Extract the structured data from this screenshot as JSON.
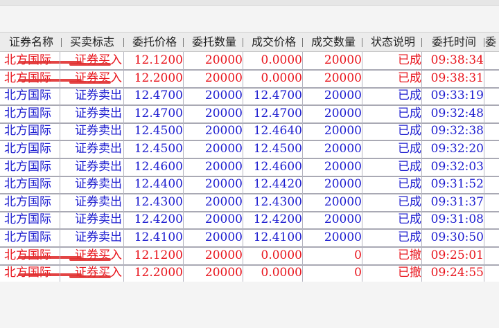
{
  "colors": {
    "buy": "#e8141c",
    "sell": "#1c1ccf",
    "header_text": "#222222",
    "strike_mark": "#e03030"
  },
  "columns": [
    {
      "key": "name",
      "label": "证券名称"
    },
    {
      "key": "direction",
      "label": "买卖标志"
    },
    {
      "key": "order_price",
      "label": "委托价格"
    },
    {
      "key": "order_qty",
      "label": "委托数量"
    },
    {
      "key": "deal_price",
      "label": "成交价格"
    },
    {
      "key": "deal_qty",
      "label": "成交数量"
    },
    {
      "key": "status",
      "label": "状态说明"
    },
    {
      "key": "order_time",
      "label": "委托时间"
    },
    {
      "key": "extra",
      "label": "委"
    }
  ],
  "rows": [
    {
      "name": "北方国际",
      "direction": "证券买入",
      "order_price": "12.1200",
      "order_qty": "20000",
      "deal_price": "0.0000",
      "deal_qty": "20000",
      "status": "已成",
      "order_time": "09:38:34",
      "side": "buy",
      "redacted": true
    },
    {
      "name": "北方国际",
      "direction": "证券买入",
      "order_price": "12.2000",
      "order_qty": "20000",
      "deal_price": "0.0000",
      "deal_qty": "20000",
      "status": "已成",
      "order_time": "09:38:31",
      "side": "buy",
      "redacted": true
    },
    {
      "name": "北方国际",
      "direction": "证券卖出",
      "order_price": "12.4700",
      "order_qty": "20000",
      "deal_price": "12.4700",
      "deal_qty": "20000",
      "status": "已成",
      "order_time": "09:33:19",
      "side": "sell",
      "redacted": false
    },
    {
      "name": "北方国际",
      "direction": "证券卖出",
      "order_price": "12.4700",
      "order_qty": "20000",
      "deal_price": "12.4700",
      "deal_qty": "20000",
      "status": "已成",
      "order_time": "09:32:48",
      "side": "sell",
      "redacted": false
    },
    {
      "name": "北方国际",
      "direction": "证券卖出",
      "order_price": "12.4500",
      "order_qty": "20000",
      "deal_price": "12.4640",
      "deal_qty": "20000",
      "status": "已成",
      "order_time": "09:32:38",
      "side": "sell",
      "redacted": false
    },
    {
      "name": "北方国际",
      "direction": "证券卖出",
      "order_price": "12.4500",
      "order_qty": "20000",
      "deal_price": "12.4500",
      "deal_qty": "20000",
      "status": "已成",
      "order_time": "09:32:20",
      "side": "sell",
      "redacted": false
    },
    {
      "name": "北方国际",
      "direction": "证券卖出",
      "order_price": "12.4600",
      "order_qty": "20000",
      "deal_price": "12.4600",
      "deal_qty": "20000",
      "status": "已成",
      "order_time": "09:32:03",
      "side": "sell",
      "redacted": false
    },
    {
      "name": "北方国际",
      "direction": "证券卖出",
      "order_price": "12.4400",
      "order_qty": "20000",
      "deal_price": "12.4420",
      "deal_qty": "20000",
      "status": "已成",
      "order_time": "09:31:52",
      "side": "sell",
      "redacted": false
    },
    {
      "name": "北方国际",
      "direction": "证券卖出",
      "order_price": "12.4300",
      "order_qty": "20000",
      "deal_price": "12.4300",
      "deal_qty": "20000",
      "status": "已成",
      "order_time": "09:31:37",
      "side": "sell",
      "redacted": false
    },
    {
      "name": "北方国际",
      "direction": "证券卖出",
      "order_price": "12.4200",
      "order_qty": "20000",
      "deal_price": "12.4200",
      "deal_qty": "20000",
      "status": "已成",
      "order_time": "09:31:08",
      "side": "sell",
      "redacted": false
    },
    {
      "name": "北方国际",
      "direction": "证券卖出",
      "order_price": "12.4100",
      "order_qty": "20000",
      "deal_price": "12.4100",
      "deal_qty": "20000",
      "status": "已成",
      "order_time": "09:30:50",
      "side": "sell",
      "redacted": false
    },
    {
      "name": "北方国际",
      "direction": "证券买入",
      "order_price": "12.1200",
      "order_qty": "20000",
      "deal_price": "0.0000",
      "deal_qty": "0",
      "status": "已撤",
      "order_time": "09:25:01",
      "side": "buy",
      "redacted": true
    },
    {
      "name": "北方国际",
      "direction": "证券买入",
      "order_price": "12.2000",
      "order_qty": "20000",
      "deal_price": "0.0000",
      "deal_qty": "0",
      "status": "已撤",
      "order_time": "09:24:55",
      "side": "buy",
      "redacted": true
    }
  ]
}
